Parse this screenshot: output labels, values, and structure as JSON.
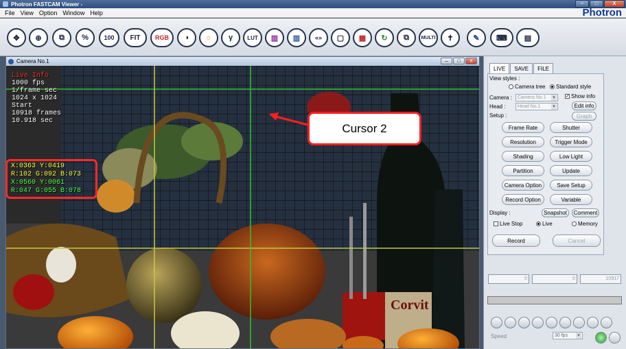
{
  "window": {
    "title": "Photron FASTCAM Viewer -",
    "brand": "Photron",
    "controls": [
      "–",
      "□",
      "X"
    ]
  },
  "menu": [
    "File",
    "View",
    "Option",
    "Window",
    "Help"
  ],
  "toolbar": {
    "buttons": [
      {
        "name": "move",
        "label": "✥"
      },
      {
        "name": "zoom",
        "label": "⊕"
      },
      {
        "name": "crop",
        "label": "⧉"
      },
      {
        "name": "percent",
        "label": "%"
      },
      {
        "name": "zoom-100",
        "label": "100"
      },
      {
        "name": "fit",
        "label": "FIT"
      },
      {
        "name": "rgb",
        "label": "RGB"
      },
      {
        "name": "contrast",
        "label": "◑"
      },
      {
        "name": "brightness",
        "label": "☼"
      },
      {
        "name": "gamma",
        "label": "γ"
      },
      {
        "name": "lut-reset",
        "label": "LUT"
      },
      {
        "name": "color-bars",
        "label": "▥"
      },
      {
        "name": "color-reset",
        "label": "▥"
      },
      {
        "name": "overlay",
        "label": "«»"
      },
      {
        "name": "frame",
        "label": "▢"
      },
      {
        "name": "multi-view",
        "label": "▦"
      },
      {
        "name": "refresh",
        "label": "↻"
      },
      {
        "name": "image-compare",
        "label": "⧉"
      },
      {
        "name": "multi-lock",
        "label": "MULTI"
      },
      {
        "name": "cursor-tool",
        "label": "✝"
      },
      {
        "name": "pen",
        "label": "✎"
      },
      {
        "name": "keyboard",
        "label": "⌨"
      },
      {
        "name": "drive",
        "label": "▤"
      }
    ]
  },
  "camera_window": {
    "title": "Camera No.1",
    "controls": [
      "–",
      "□",
      "X"
    ],
    "osd": {
      "status": "Live Info",
      "fps": "1000 fps",
      "shutter": "1/frame sec",
      "resolution": "1024 x 1024",
      "trigger": "Start",
      "frames": "10918 frames",
      "time": "10.918 sec"
    },
    "cursor1_pos": "X:0363 Y:0419",
    "cursor1_rgb": "R:102 G:092 B:073",
    "cursor2_pos": "X:0560 Y:0061",
    "cursor2_rgb": "R:047 G:055 B:078"
  },
  "callout": {
    "text": "Cursor 2"
  },
  "panel": {
    "tabs": [
      "LIVE",
      "SAVE",
      "FILE"
    ],
    "view_styles_label": "View styles :",
    "camera_tree": "Camera tree",
    "standard_style": "Standard style",
    "camera_label": "Camera :",
    "camera_value": "Camera No.1",
    "head_label": "Head :",
    "head_value": "Head No.1",
    "show_info": "Show info",
    "edit_info": "Edit info",
    "graph": "Graph",
    "setup_label": "Setup :",
    "setup_buttons": [
      "Frame Rate",
      "Shutter",
      "Resolution",
      "Trigger Mode",
      "Shading",
      "Low Light",
      "Partition",
      "Update",
      "Camera Option",
      "Save Setup",
      "Record Option",
      "Variable"
    ],
    "display_label": "Display :",
    "snapshot": "Snapshot",
    "comment": "Comment",
    "live_stop": "Live Stop",
    "live": "Live",
    "memory": "Memory",
    "record": "Record",
    "cancel": "Cancel",
    "seek_start": "0",
    "seek_mid": "0",
    "seek_end": "10917",
    "frame_rate_select": "30 fps",
    "speed_label": "Speed"
  }
}
